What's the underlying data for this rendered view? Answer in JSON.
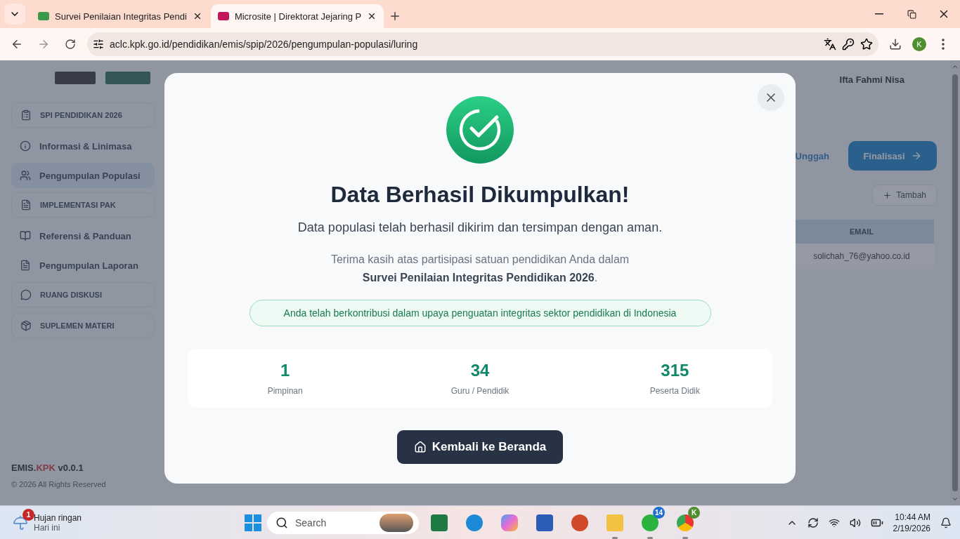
{
  "browser": {
    "tabs": [
      {
        "title": "Survei Penilaian Integritas Pendi",
        "selected": false
      },
      {
        "title": "Microsite | Direktorat Jejaring P",
        "selected": true
      }
    ],
    "url": "aclc.kpk.go.id/pendidikan/emis/spip/2026/pengumpulan-populasi/luring",
    "profile": "K"
  },
  "sidebar": {
    "items": [
      {
        "label": "SPI PENDIDIKAN 2026",
        "kind": "section",
        "selected": false
      },
      {
        "label": "Informasi & Linimasa",
        "kind": "link",
        "selected": false
      },
      {
        "label": "Pengumpulan Populasi",
        "kind": "link",
        "selected": true
      },
      {
        "label": "IMPLEMENTASI PAK",
        "kind": "section",
        "selected": false
      },
      {
        "label": "Referensi & Panduan",
        "kind": "link",
        "selected": false
      },
      {
        "label": "Pengumpulan Laporan",
        "kind": "link",
        "selected": false
      },
      {
        "label": "RUANG DISKUSI",
        "kind": "section",
        "selected": false
      },
      {
        "label": "SUPLEMEN MATERI",
        "kind": "section",
        "selected": false
      }
    ],
    "footer": {
      "app": "EMIS.",
      "brand": "KPK",
      "version": "v0.0.1",
      "copyright": "© 2026 All Rights Reserved"
    }
  },
  "user": {
    "name": "Ifta Fahmi Nisa"
  },
  "actions": {
    "upload": "Unggah",
    "finalize": "Finalisasi",
    "add": "Tambah"
  },
  "table": {
    "column": "EMAIL",
    "cell": "solichah_76@yahoo.co.id"
  },
  "modal": {
    "title": "Data Berhasil Dikumpulkan!",
    "subtitle": "Data populasi telah berhasil dikirim dan tersimpan dengan aman.",
    "thanks": "Terima kasih atas partisipasi satuan pendidikan Anda dalam **Survei Penilaian Integritas Pendidikan 2026**.",
    "note": "Anda telah berkontribusi dalam upaya penguatan integritas sektor pendidikan di Indonesia",
    "stats": [
      {
        "value": "1",
        "label": "Pimpinan"
      },
      {
        "value": "34",
        "label": "Guru / Pendidik"
      },
      {
        "value": "315",
        "label": "Peserta Didik"
      }
    ],
    "button": "Kembali ke Beranda"
  },
  "taskbar": {
    "weather": {
      "badge": "1",
      "title": "Hujan ringan",
      "subtitle": "Hari ini"
    },
    "search": "Search",
    "apps": [
      {
        "kind": "excel",
        "running": false
      },
      {
        "kind": "edge",
        "running": false
      },
      {
        "kind": "copilot",
        "running": false
      },
      {
        "kind": "word",
        "running": false
      },
      {
        "kind": "powerpoint",
        "running": false
      },
      {
        "kind": "files",
        "running": true
      },
      {
        "kind": "whatsapp",
        "badge": "14",
        "running": true
      },
      {
        "kind": "chrome",
        "badge": "K",
        "running": true
      }
    ],
    "time": "10:44 AM",
    "date": "2/19/2026"
  }
}
